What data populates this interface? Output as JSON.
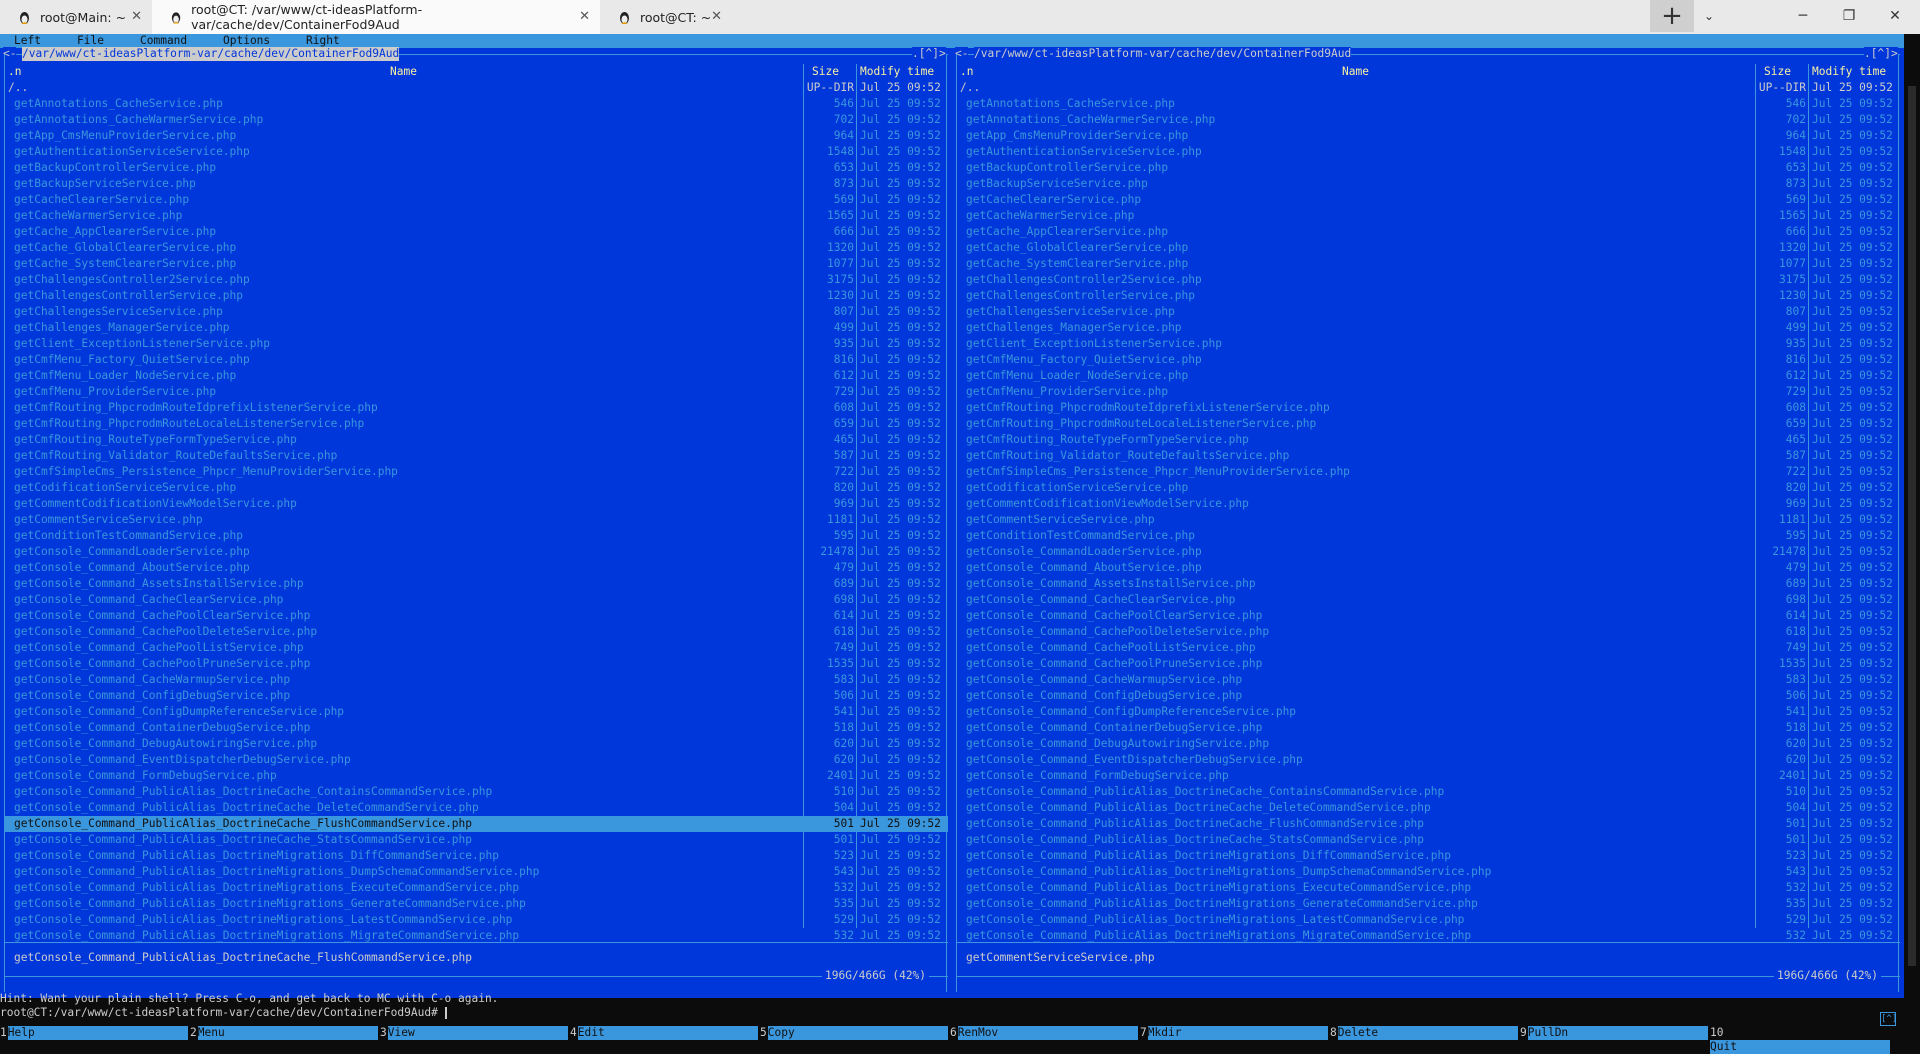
{
  "tabs": [
    {
      "label": "root@Main: ~",
      "active": false
    },
    {
      "label": "root@CT: /var/www/ct-ideasPlatform-var/cache/dev/ContainerFod9Aud",
      "active": true
    },
    {
      "label": "root@CT: ~",
      "active": false
    }
  ],
  "tabbar": {
    "new_tab": "+",
    "dropdown": "⌄",
    "minimize": "─",
    "restore": "❐",
    "close": "✕"
  },
  "menubar": [
    "Left",
    "File",
    "Command",
    "Options",
    "Right"
  ],
  "panels": {
    "left": {
      "path": "/var/www/ct-ideasPlatform-var/cache/dev/ContainerFod9Aud",
      "header_left_marker": "<-",
      "header_right_marker": ".[^]>",
      "ministatus": "getConsole_Command_PublicAlias_DoctrineCache_FlushCommandService.php",
      "disk": "196G/466G (42%)"
    },
    "right": {
      "path": "/var/www/ct-ideasPlatform-var/cache/dev/ContainerFod9Aud",
      "header_left_marker": "<-",
      "header_right_marker": ".[^]>",
      "ministatus": "getCommentServiceService.php",
      "disk": "196G/466G (42%)"
    }
  },
  "columns": {
    "sort": ".n",
    "name": "Name",
    "size": "Size",
    "mtime": "Modify time"
  },
  "parent_row": {
    "name": "/..",
    "size": "UP--DIR",
    "mtime": "Jul 25 09:52"
  },
  "files": [
    {
      "name": "getAnnotations_CacheService.php",
      "size": "546"
    },
    {
      "name": "getAnnotations_CacheWarmerService.php",
      "size": "702"
    },
    {
      "name": "getApp_CmsMenuProviderService.php",
      "size": "964"
    },
    {
      "name": "getAuthenticationServiceService.php",
      "size": "1548"
    },
    {
      "name": "getBackupControllerService.php",
      "size": "653"
    },
    {
      "name": "getBackupServiceService.php",
      "size": "873"
    },
    {
      "name": "getCacheClearerService.php",
      "size": "569"
    },
    {
      "name": "getCacheWarmerService.php",
      "size": "1565"
    },
    {
      "name": "getCache_AppClearerService.php",
      "size": "666"
    },
    {
      "name": "getCache_GlobalClearerService.php",
      "size": "1320"
    },
    {
      "name": "getCache_SystemClearerService.php",
      "size": "1077"
    },
    {
      "name": "getChallengesController2Service.php",
      "size": "3175"
    },
    {
      "name": "getChallengesControllerService.php",
      "size": "1230"
    },
    {
      "name": "getChallengesServiceService.php",
      "size": "807"
    },
    {
      "name": "getChallenges_ManagerService.php",
      "size": "499"
    },
    {
      "name": "getClient_ExceptionListenerService.php",
      "size": "935"
    },
    {
      "name": "getCmfMenu_Factory_QuietService.php",
      "size": "816"
    },
    {
      "name": "getCmfMenu_Loader_NodeService.php",
      "size": "612"
    },
    {
      "name": "getCmfMenu_ProviderService.php",
      "size": "729"
    },
    {
      "name": "getCmfRouting_PhpcrodmRouteIdprefixListenerService.php",
      "size": "608"
    },
    {
      "name": "getCmfRouting_PhpcrodmRouteLocaleListenerService.php",
      "size": "659"
    },
    {
      "name": "getCmfRouting_RouteTypeFormTypeService.php",
      "size": "465"
    },
    {
      "name": "getCmfRouting_Validator_RouteDefaultsService.php",
      "size": "587"
    },
    {
      "name": "getCmfSimpleCms_Persistence_Phpcr_MenuProviderService.php",
      "size": "722"
    },
    {
      "name": "getCodificationServiceService.php",
      "size": "820"
    },
    {
      "name": "getCommentCodificationViewModelService.php",
      "size": "969"
    },
    {
      "name": "getCommentServiceService.php",
      "size": "1181"
    },
    {
      "name": "getConditionTestCommandService.php",
      "size": "595"
    },
    {
      "name": "getConsole_CommandLoaderService.php",
      "size": "21478"
    },
    {
      "name": "getConsole_Command_AboutService.php",
      "size": "479"
    },
    {
      "name": "getConsole_Command_AssetsInstallService.php",
      "size": "689"
    },
    {
      "name": "getConsole_Command_CacheClearService.php",
      "size": "698"
    },
    {
      "name": "getConsole_Command_CachePoolClearService.php",
      "size": "614"
    },
    {
      "name": "getConsole_Command_CachePoolDeleteService.php",
      "size": "618"
    },
    {
      "name": "getConsole_Command_CachePoolListService.php",
      "size": "749"
    },
    {
      "name": "getConsole_Command_CachePoolPruneService.php",
      "size": "1535"
    },
    {
      "name": "getConsole_Command_CacheWarmupService.php",
      "size": "583"
    },
    {
      "name": "getConsole_Command_ConfigDebugService.php",
      "size": "506"
    },
    {
      "name": "getConsole_Command_ConfigDumpReferenceService.php",
      "size": "541"
    },
    {
      "name": "getConsole_Command_ContainerDebugService.php",
      "size": "518"
    },
    {
      "name": "getConsole_Command_DebugAutowiringService.php",
      "size": "620"
    },
    {
      "name": "getConsole_Command_EventDispatcherDebugService.php",
      "size": "620"
    },
    {
      "name": "getConsole_Command_FormDebugService.php",
      "size": "2401"
    },
    {
      "name": "getConsole_Command_PublicAlias_DoctrineCache_ContainsCommandService.php",
      "size": "510"
    },
    {
      "name": "getConsole_Command_PublicAlias_DoctrineCache_DeleteCommandService.php",
      "size": "504"
    },
    {
      "name": "getConsole_Command_PublicAlias_DoctrineCache_FlushCommandService.php",
      "size": "501"
    },
    {
      "name": "getConsole_Command_PublicAlias_DoctrineCache_StatsCommandService.php",
      "size": "501"
    },
    {
      "name": "getConsole_Command_PublicAlias_DoctrineMigrations_DiffCommandService.php",
      "size": "523"
    },
    {
      "name": "getConsole_Command_PublicAlias_DoctrineMigrations_DumpSchemaCommandService.php",
      "size": "543"
    },
    {
      "name": "getConsole_Command_PublicAlias_DoctrineMigrations_ExecuteCommandService.php",
      "size": "532"
    },
    {
      "name": "getConsole_Command_PublicAlias_DoctrineMigrations_GenerateCommandService.php",
      "size": "535"
    },
    {
      "name": "getConsole_Command_PublicAlias_DoctrineMigrations_LatestCommandService.php",
      "size": "529"
    },
    {
      "name": "getConsole_Command_PublicAlias_DoctrineMigrations_MigrateCommandService.php",
      "size": "532"
    }
  ],
  "file_mtime": "Jul 25 09:52",
  "selected_index_left": 45,
  "hint": "Hint: Want your plain shell? Press C-o, and get back to MC with C-o again.",
  "prompt": "root@CT:/var/www/ct-ideasPlatform-var/cache/dev/ContainerFod9Aud# ",
  "resize_indicator": "[^]",
  "fkeys": [
    {
      "num": "1",
      "label": "Help"
    },
    {
      "num": "2",
      "label": "Menu"
    },
    {
      "num": "3",
      "label": "View"
    },
    {
      "num": "4",
      "label": "Edit"
    },
    {
      "num": "5",
      "label": "Copy"
    },
    {
      "num": "6",
      "label": "RenMov"
    },
    {
      "num": "7",
      "label": "Mkdir"
    },
    {
      "num": "8",
      "label": "Delete"
    },
    {
      "num": "9",
      "label": "PullDn"
    },
    {
      "num": "10",
      "label": "Quit"
    }
  ]
}
